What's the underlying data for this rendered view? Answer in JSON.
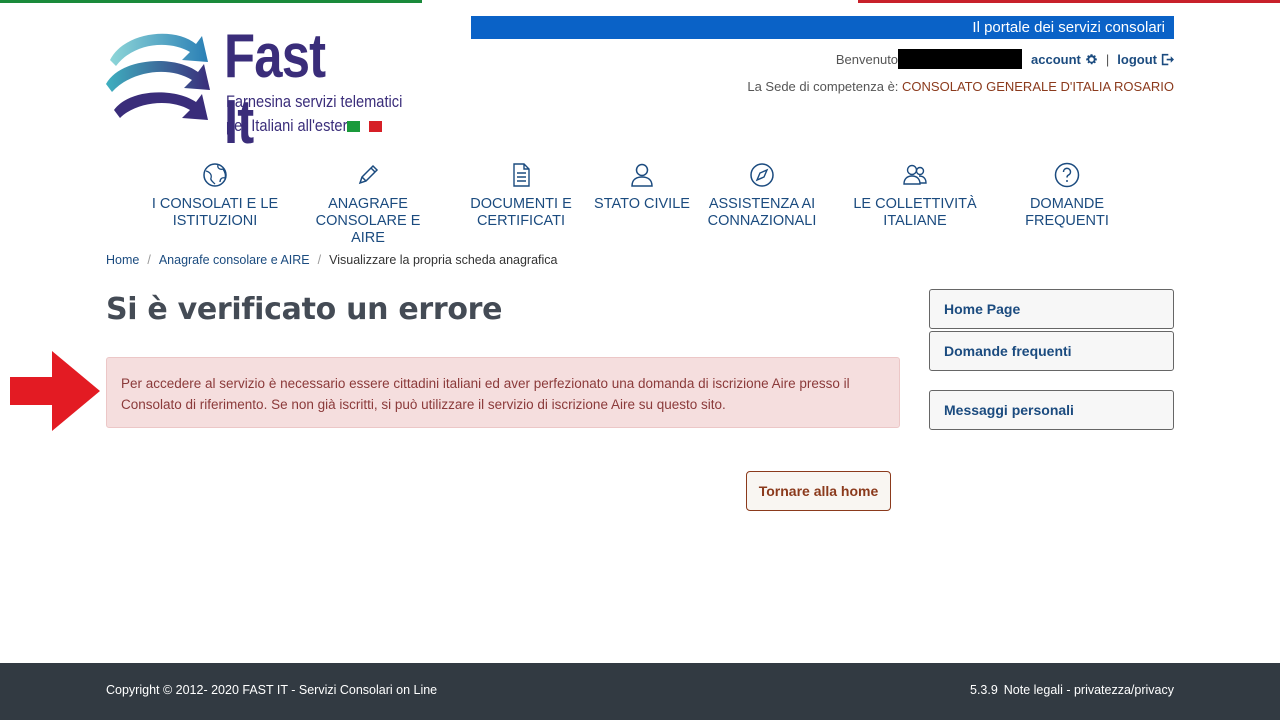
{
  "header": {
    "logo": {
      "title": "Fast It",
      "subtitle_line1": "Farnesina servizi telematici",
      "subtitle_line2": "per Italiani all'estero"
    },
    "portal_banner": "Il portale dei servizi consolari",
    "welcome_label": "Benvenuto",
    "account_label": "account",
    "logout_label": "logout",
    "separator": "|",
    "sede_label": "La Sede di competenza è:",
    "sede_value": "CONSOLATO GENERALE D'ITALIA ROSARIO"
  },
  "nav": {
    "items": [
      {
        "line1": "I CONSOLATI E LE",
        "line2": "ISTITUZIONI",
        "icon": "globe-icon"
      },
      {
        "line1": "ANAGRAFE",
        "line2": "CONSOLARE E AIRE",
        "icon": "pencil-icon"
      },
      {
        "line1": "DOCUMENTI E",
        "line2": "CERTIFICATI",
        "icon": "document-icon"
      },
      {
        "line1": "STATO CIVILE",
        "line2": "",
        "icon": "person-icon"
      },
      {
        "line1": "ASSISTENZA AI",
        "line2": "CONNAZIONALI",
        "icon": "compass-icon"
      },
      {
        "line1": "LE COLLETTIVITÀ",
        "line2": "ITALIANE",
        "icon": "people-icon"
      },
      {
        "line1": "DOMANDE FREQUENTI",
        "line2": "",
        "icon": "question-icon"
      }
    ]
  },
  "breadcrumb": {
    "home": "Home",
    "section": "Anagrafe consolare e AIRE",
    "current": "Visualizzare la propria scheda anagrafica",
    "separator": "/"
  },
  "main": {
    "title": "Si è verificato un errore",
    "alert_text": "Per accedere al servizio è necessario essere cittadini italiani ed aver perfezionato una domanda di iscrizione Aire presso il Consolato di riferimento. Se non già iscritti, si può utilizzare il servizio di iscrizione Aire su questo sito.",
    "back_button": "Tornare alla home"
  },
  "sidebar": {
    "home_page": "Home Page",
    "faq": "Domande frequenti",
    "messages": "Messaggi personali"
  },
  "footer": {
    "copyright": "Copyright © 2012- 2020 FAST IT - Servizi Consolari on Line",
    "version": "5.3.9",
    "legal": "Note legali - privatezza/privacy"
  },
  "colors": {
    "brand": "#3a2d7a",
    "banner": "#0a62c7",
    "link": "#1b4b7f",
    "alert_bg": "#f5dede",
    "alert_text": "#8b3a3a",
    "footer_bg": "#323a42",
    "annotation_arrow": "#e31b23"
  }
}
